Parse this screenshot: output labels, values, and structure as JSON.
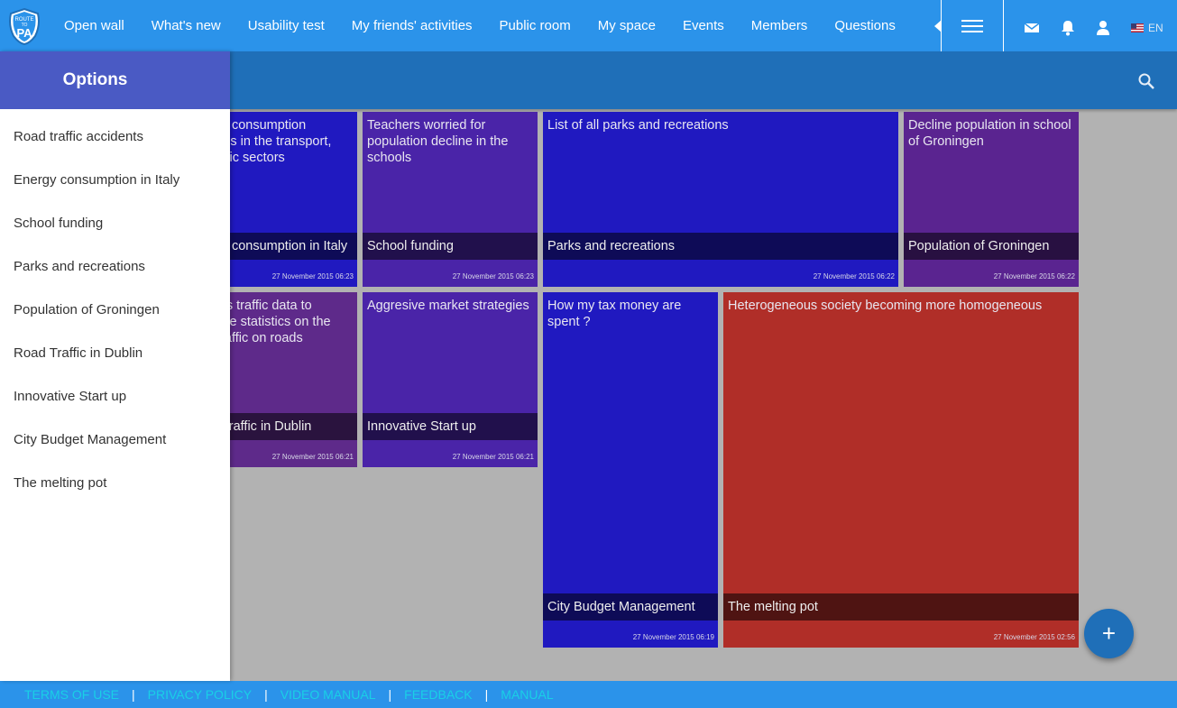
{
  "header": {
    "logo_text": "ROUTE TO PA",
    "nav_items": [
      "Open wall",
      "What's new",
      "Usability test",
      "My friends' activities",
      "Public room",
      "My space",
      "Events",
      "Members",
      "Questions"
    ],
    "language": "EN"
  },
  "drawer": {
    "title": "Options",
    "items": [
      "Road traffic accidents",
      "Energy consumption in Italy",
      "School funding",
      "Parks and recreations",
      "Population of Groningen",
      "Road Traffic in Dublin",
      "Innovative Start up",
      "City Budget Management",
      "The melting pot"
    ]
  },
  "tiles": [
    {
      "description": "Energy consumption statistics in the transport, domestic sectors",
      "title": "Energy consumption in Italy",
      "date": "27 November 2015 06:23",
      "color": "#2019c0"
    },
    {
      "description": "Teachers worried for population decline in the schools",
      "title": "School funding",
      "date": "27 November 2015 06:23",
      "color": "#4a24a8"
    },
    {
      "description": "List of all parks and recreations",
      "title": "Parks and recreations",
      "date": "27 November 2015 06:22",
      "color": "#2019c0"
    },
    {
      "description": "Decline population in school of Groningen",
      "title": "Population of Groningen",
      "date": "27 November 2015 06:22",
      "color": "#5a2490"
    },
    {
      "description": "Dublin's traffic data to compute statistics on the road traffic on roads",
      "title": "Road Traffic in Dublin",
      "date": "27 November 2015 06:21",
      "color": "#5e2a8a"
    },
    {
      "description": "Aggresive market strategies",
      "title": "Innovative Start up",
      "date": "27 November 2015 06:21",
      "color": "#4a24a8"
    },
    {
      "description": "How my tax money are spent ?",
      "title": "City Budget Management",
      "date": "27 November 2015 06:19",
      "color": "#2019c0"
    },
    {
      "description": "Heterogeneous society becoming more homogeneous",
      "title": "The melting pot",
      "date": "27 November 2015 02:56",
      "color": "#b02e28"
    }
  ],
  "fab_label": "+",
  "footer": {
    "links": [
      "TERMS OF USE",
      "PRIVACY POLICY",
      "VIDEO MANUAL",
      "FEEDBACK",
      "MANUAL"
    ],
    "separator": "|"
  }
}
